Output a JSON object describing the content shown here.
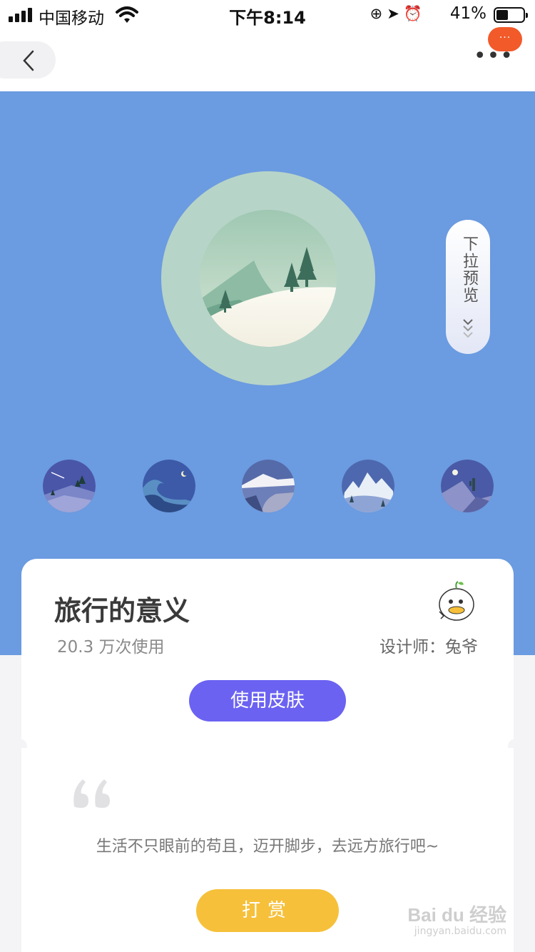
{
  "status_bar": {
    "carrier": "中国移动",
    "time": "下午8:14",
    "battery": "41%",
    "battery_level": 0.41,
    "icons": [
      "signal-icon",
      "wifi-icon",
      "rotation-lock-icon",
      "location-icon",
      "alarm-icon",
      "battery-icon"
    ]
  },
  "nav": {
    "back_icon": "chevron-left-icon",
    "more_icon": "more-dots-icon",
    "badge_text": "···"
  },
  "preview": {
    "pull_label": "下拉预览",
    "pull_icon": "double-chevron-down-icon"
  },
  "thumbnails": [
    {
      "name": "shooting-star-mountain"
    },
    {
      "name": "night-wave"
    },
    {
      "name": "snow-mountain-lake"
    },
    {
      "name": "snow-peaks"
    },
    {
      "name": "desert-moon"
    }
  ],
  "skin": {
    "title": "旅行的意义",
    "usage": "20.3 万次使用",
    "designer_label": "设计师：",
    "designer_name": "兔爷",
    "use_button": "使用皮肤",
    "quote": "生活不只眼前的苟且，迈开脚步，去远方旅行吧~",
    "tip_button": "打赏"
  },
  "watermark": {
    "main": "Bai du 经验",
    "sub": "jingyan.baidu.com"
  },
  "colors": {
    "hero_bg": "#6b9be0",
    "use_button": "#6b62f2",
    "tip_button": "#f6c03a",
    "badge": "#f25a2a"
  }
}
